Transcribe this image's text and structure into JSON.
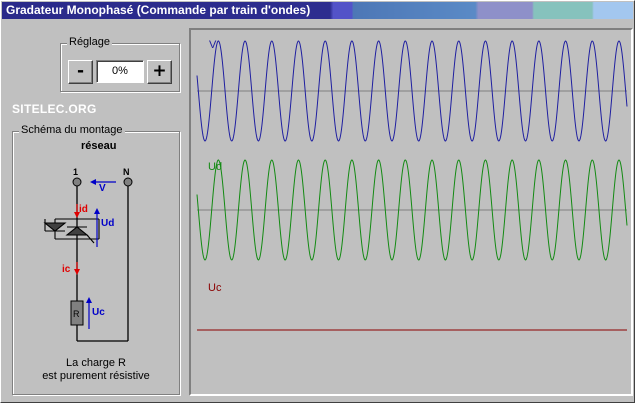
{
  "window": {
    "title": "Gradateur Monophasé (Commande par train d'ondes)"
  },
  "reglage": {
    "label": "Réglage",
    "minus_label": "-",
    "plus_label": "+",
    "value": "0%"
  },
  "brand": "SITELEC.ORG",
  "schema": {
    "label": "Schéma du montage",
    "heading": "réseau",
    "node_1": "1",
    "node_n": "N",
    "label_v": "V",
    "label_id": "id",
    "label_ud": "Ud",
    "label_ic": "ic",
    "label_r": "R",
    "label_uc": "Uc",
    "caption_line1": "La charge  R",
    "caption_line2": "est purement résistive"
  },
  "oscilloscope": {
    "traces": [
      {
        "name": "V",
        "color": "#1f1fa0",
        "amplitude": 1,
        "cycles": 16
      },
      {
        "name": "Ud",
        "color": "#138a13",
        "amplitude": 1,
        "cycles": 16
      },
      {
        "name": "Uc",
        "color": "#8b0000",
        "amplitude": 0,
        "cycles": 16
      }
    ]
  },
  "colors": {
    "current_arrow": "#e00000",
    "voltage_arrow": "#0000c8",
    "wire": "#000000"
  }
}
